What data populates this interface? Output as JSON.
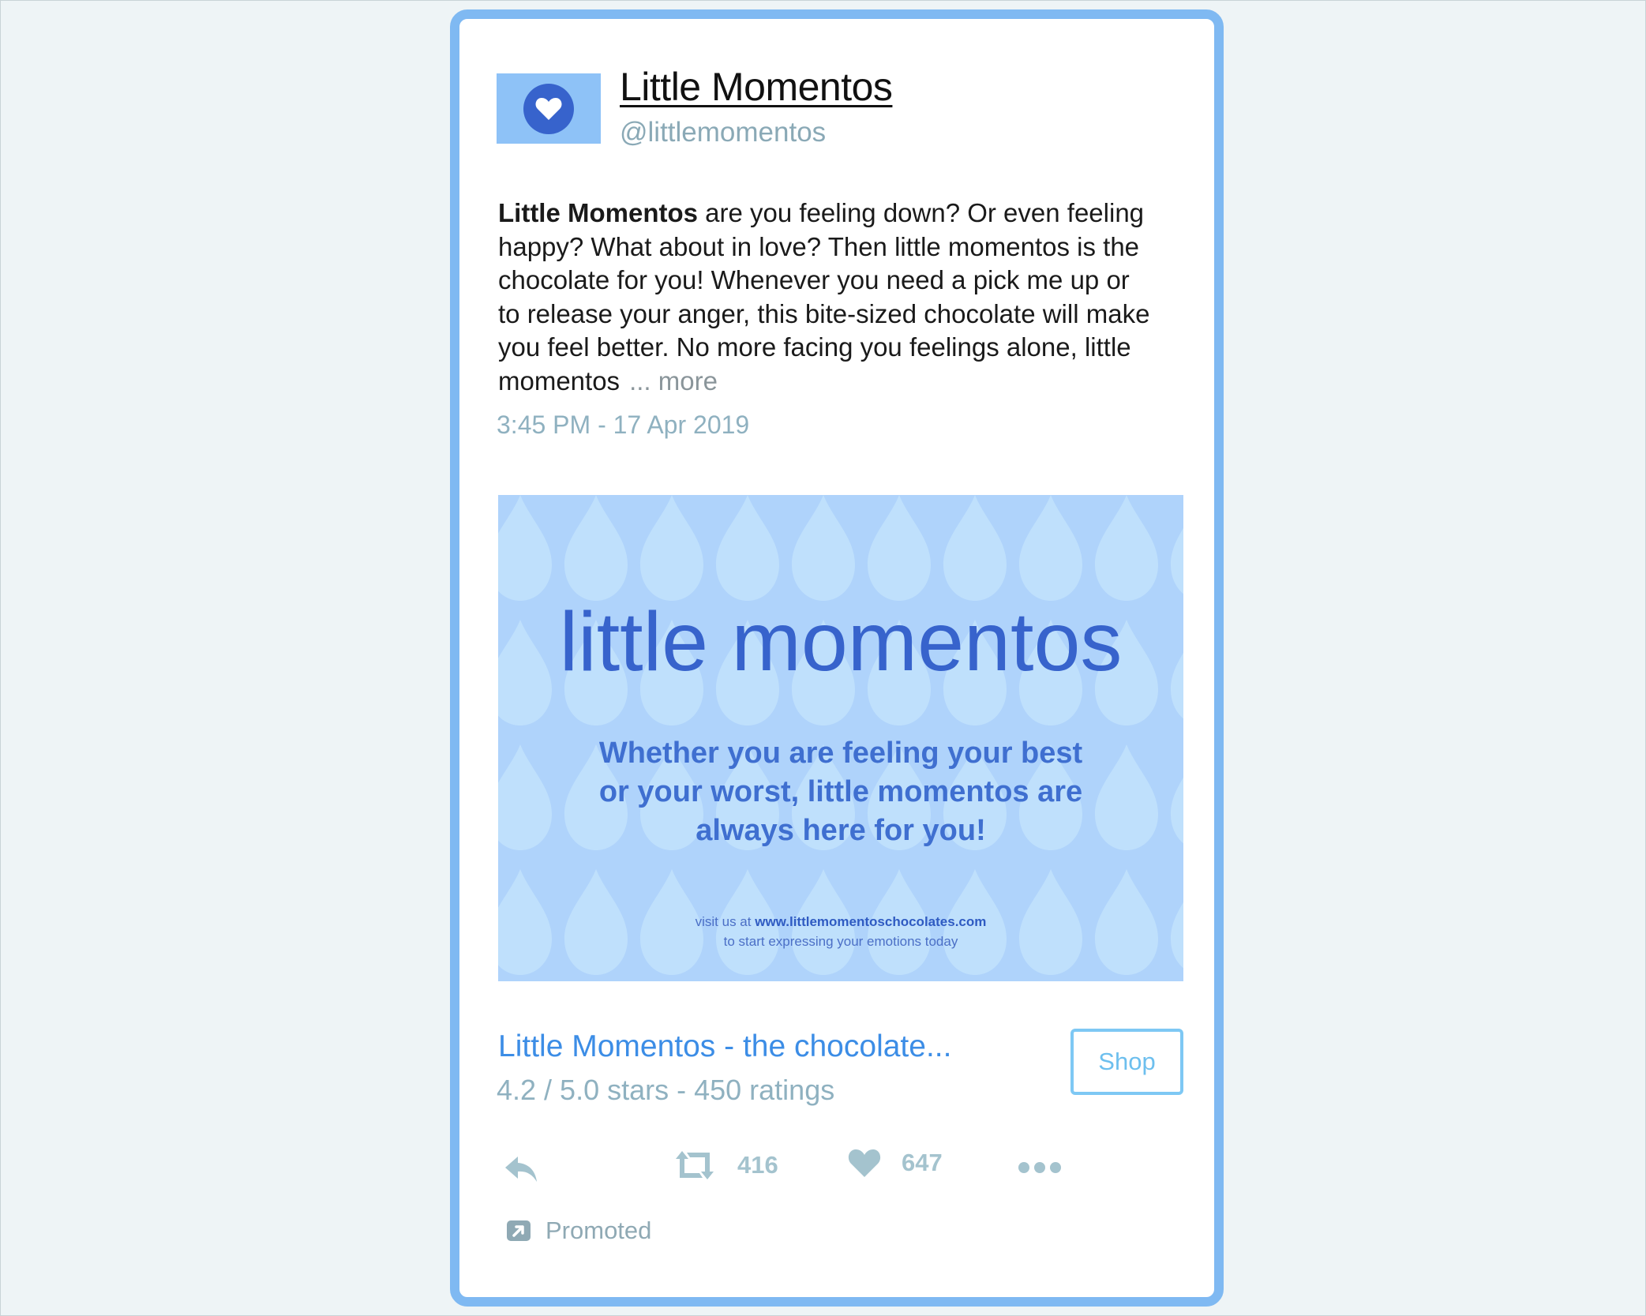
{
  "account": {
    "display_name": "Little Momentos",
    "handle": "@littlemomentos",
    "avatar_icon": "heart-icon"
  },
  "tweet": {
    "bold_lead": "Little Momentos",
    "body": " are you feeling down? Or even feeling happy? What about in love? Then little momentos is the chocolate for you! Whenever you need a pick me up or to release your anger, this bite-sized chocolate will make you feel better. No more facing you feelings alone, little momentos",
    "more_label": "... more",
    "timestamp": "3:45 PM - 17 Apr 2019"
  },
  "ad": {
    "logo_text": "little momentos",
    "tagline_lines": [
      "Whether you are feeling your best",
      "or your worst, little momentos are",
      "always here for you!"
    ],
    "visit_prefix": "visit us at ",
    "visit_url": "www.littlemomentoschocolates.com",
    "visit_suffix": "to start expressing your emotions today"
  },
  "card": {
    "title": "Little Momentos - the chocolate...",
    "rating": "4.2 / 5.0 stars - 450 ratings",
    "shop_label": "Shop"
  },
  "actions": {
    "retweet_count": "416",
    "like_count": "647"
  },
  "promoted_label": "Promoted",
  "colors": {
    "card_border": "#7fb9f2",
    "brand_blue": "#3763cc",
    "ad_background": "#b1d5fb",
    "link_blue": "#3c8de6",
    "muted": "#8fb1c0"
  }
}
